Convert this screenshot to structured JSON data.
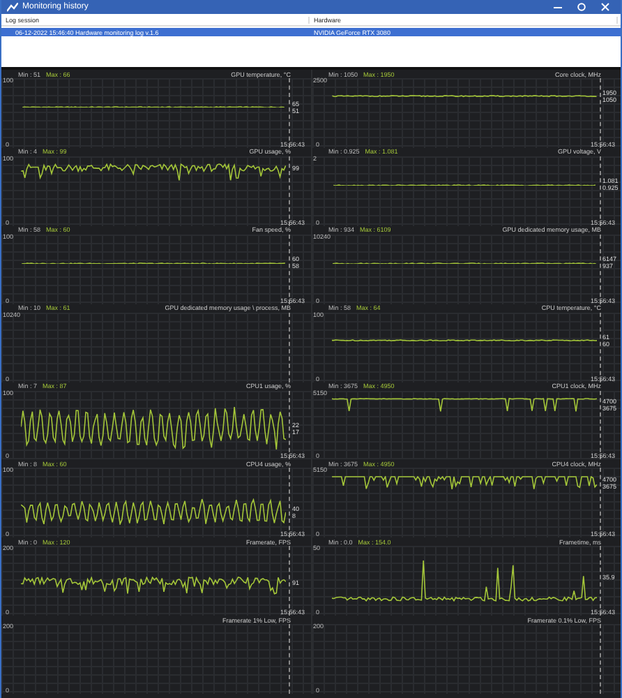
{
  "window": {
    "title": "Monitoring history"
  },
  "log_table": {
    "columns": [
      "Log session",
      "Hardware"
    ],
    "rows": [
      {
        "cells": [
          "06-12-2022 15:46:40 Hardware monitoring log v.1.6",
          "NVIDIA GeForce RTX 3080"
        ],
        "selected": true
      }
    ]
  },
  "graphs": {
    "left": [
      {
        "min_label": "Min : 51",
        "max_label": "Max : 66",
        "title": "GPU temperature, °C",
        "y_max": "100",
        "y_min": "0",
        "time": "15:56:43",
        "values": [
          "65",
          "51"
        ],
        "trace": {
          "kind": "flat-mid"
        }
      },
      {
        "min_label": "Min : 4",
        "max_label": "Max : 99",
        "title": "GPU usage, %",
        "y_max": "100",
        "y_min": "0",
        "time": "15:56:43",
        "values": [
          "99"
        ],
        "trace": {
          "kind": "noisy-high"
        }
      },
      {
        "min_label": "Min : 58",
        "max_label": "Max : 60",
        "title": "Fan speed, %",
        "y_max": "100",
        "y_min": "0",
        "time": "15:56:43",
        "values": [
          "60",
          "58"
        ],
        "trace": {
          "kind": "flat-mid"
        }
      },
      {
        "min_label": "Min : 10",
        "max_label": "Max : 61",
        "title": "GPU dedicated memory usage \\ process, MB",
        "y_max": "10240",
        "y_min": "0"
      },
      {
        "min_label": "Min : 7",
        "max_label": "Max : 87",
        "title": "CPU1 usage, %",
        "y_max": "100",
        "y_min": "0",
        "time": "15:56:43",
        "values": [
          "22",
          "17"
        ],
        "trace": {
          "kind": "wave"
        }
      },
      {
        "min_label": "Min : 8",
        "max_label": "Max : 60",
        "title": "CPU4 usage, %",
        "y_max": "100",
        "y_min": "0",
        "time": "15:56:43",
        "values": [
          "40",
          "8"
        ],
        "trace": {
          "kind": "wave-small"
        }
      },
      {
        "min_label": "Min : 0",
        "max_label": "Max : 120",
        "title": "Framerate, FPS",
        "y_max": "200",
        "y_min": "0",
        "time": "15:56:43",
        "values": [
          "91"
        ],
        "trace": {
          "kind": "noisy-mid"
        }
      },
      {
        "title": "Framerate 1% Low, FPS",
        "y_max": "200",
        "y_min": "0"
      }
    ],
    "right": [
      {
        "min_label": "Min : 1050",
        "max_label": "Max : 1950",
        "title": "Core clock, MHz",
        "y_max": "2500",
        "y_min": "0",
        "time": "15:56:43",
        "values": [
          "1950",
          "1050"
        ],
        "trace": {
          "kind": "flat-high"
        }
      },
      {
        "min_label": "Min : 0.925",
        "max_label": "Max : 1.081",
        "title": "GPU voltage, V",
        "y_max": "2",
        "y_min": "0",
        "time": "15:56:43",
        "values": [
          "1.081",
          "0.925"
        ],
        "trace": {
          "kind": "flat-mid"
        }
      },
      {
        "min_label": "Min : 934",
        "max_label": "Max : 6109",
        "title": "GPU dedicated memory usage, MB",
        "y_max": "10240",
        "y_min": "0",
        "time": "15:56:43",
        "values": [
          "6147",
          "937"
        ],
        "trace": {
          "kind": "flat-mid"
        }
      },
      {
        "min_label": "Min : 58",
        "max_label": "Max : 64",
        "title": "CPU temperature, °C",
        "y_max": "100",
        "y_min": "0",
        "time": "15:56:43",
        "values": [
          "61",
          "60"
        ],
        "trace": {
          "kind": "flat-mid"
        }
      },
      {
        "min_label": "Min : 3675",
        "max_label": "Max : 4950",
        "title": "CPU1 clock, MHz",
        "y_max": "5150",
        "y_min": "0",
        "time": "15:56:43",
        "values": [
          "4700",
          "3675"
        ],
        "trace": {
          "kind": "dips"
        }
      },
      {
        "min_label": "Min : 3675",
        "max_label": "Max : 4950",
        "title": "CPU4 clock, MHz",
        "y_max": "5150",
        "y_min": "0",
        "time": "15:56:43",
        "values": [
          "4700",
          "3675"
        ],
        "trace": {
          "kind": "dips-many"
        }
      },
      {
        "min_label": "Min : 0.0",
        "max_label": "Max : 154.0",
        "title": "Frametime, ms",
        "y_max": "50",
        "y_min": "0",
        "time": "15:56:43",
        "values": [
          "35.9"
        ],
        "trace": {
          "kind": "spikes"
        }
      },
      {
        "title": "Framerate 0.1% Low, FPS",
        "y_max": "200",
        "y_min": "0"
      }
    ]
  }
}
